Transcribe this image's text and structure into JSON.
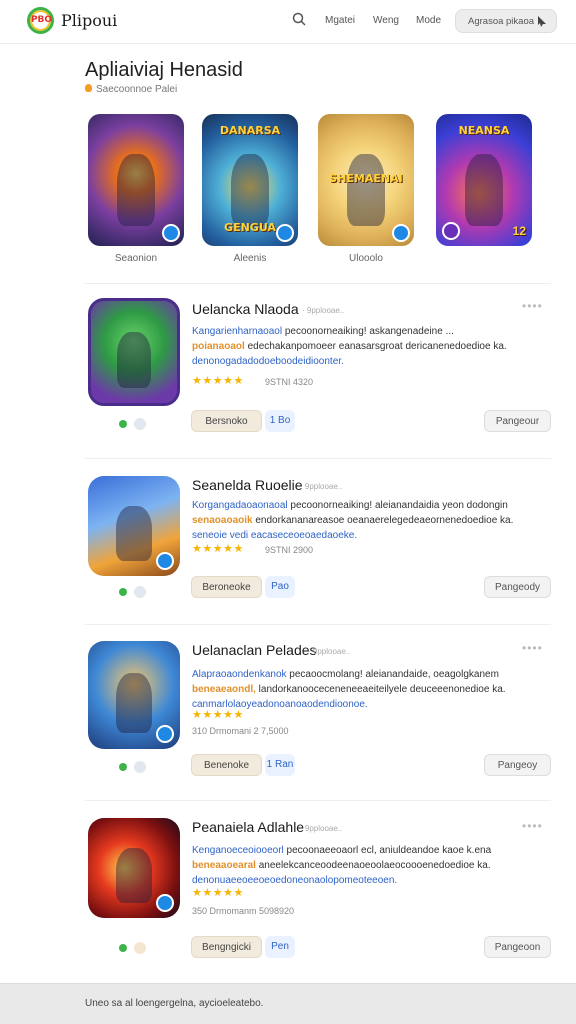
{
  "header": {
    "logo_text": "PBO",
    "brand": "Plipoui",
    "nav": [
      "Mgatei",
      "Weng",
      "Mode"
    ],
    "action_button": "Agrasoa pikaoa"
  },
  "hero": {
    "title": "Apliaiviaj Henasid",
    "subtitle": "Saecoonnoe Palei",
    "featured": [
      {
        "art_title": "DANARSA",
        "art_subtitle": "GENGUA",
        "label": "Seaonion"
      },
      {
        "art_title": "SHEMAENAI",
        "art_subtitle": "",
        "label": "Aleenis"
      },
      {
        "art_title": "SHEMAENAI",
        "art_subtitle": "",
        "label": "Ulooolo"
      },
      {
        "art_title": "NEANSA",
        "art_subtitle": "",
        "badge_number": "12",
        "label": ""
      }
    ]
  },
  "apps": [
    {
      "title": "Uelancka Nlaoda",
      "meta": "· 9pplooae..",
      "desc_lead": "Kangarienharnaoaol",
      "desc_text1": " pecoonorneaiking! askangenadeine ...",
      "desc_lead2": "poianaoaol",
      "desc_text2": " edechakanpomoeer eanasarsgroat dericanenedoedioe ka.",
      "desc_tail": "denonogadadodoeboodeidioonter.",
      "stars": "★★★★★",
      "rating_text": "9STNI 4320",
      "downloads": "",
      "primary_button": "Bersnoko",
      "chip": "1 Bo",
      "action": "Pangeour"
    },
    {
      "title": "Seanelda Ruoelie",
      "meta": "· 9pplooae..",
      "desc_lead": "Korgangadaoaonaoal",
      "desc_text1": " pecoonorneaiking! aleianandaidia yeon dodongin",
      "desc_lead2": "senaoaoaoik",
      "desc_text2": " endorkananareasoe oeanaerelegedeaeornenedoedioe ka.",
      "desc_tail": "seneoie vedi eacaseceoeoaedaoeke.",
      "stars": "★★★★★",
      "rating_text": "9STNI 2900",
      "downloads": "",
      "primary_button": "Beroneoke",
      "chip": "Pao",
      "action": "Pangeody"
    },
    {
      "title": "Uelanaclan Pelades",
      "meta": "· 9pplooae..",
      "desc_lead": "Alapraoaondenkanok",
      "desc_text1": " pecaoocmolang! aleianandaide, oeagolgkanem",
      "desc_lead2": "beneaeaondl,",
      "desc_text2": " landorkanooceceneneeaeiteilyele deuceeenonedioe ka.",
      "desc_tail": "canmarlolaoyeadonoanoaodendioonoe.",
      "stars": "★★★★★",
      "rating_text": "",
      "downloads": "310 Drmomani 2 7,5000",
      "primary_button": "Benenoke",
      "chip": "1 Ran",
      "action": "Pangeoy"
    },
    {
      "title": "Peanaiela Adlahle",
      "meta": "· 9pplooae..",
      "desc_lead": "Kenganoeceoiooeorl",
      "desc_text1": " pecoonaeeoaorl ecl, aniuldeandoe kaoe k.ena",
      "desc_lead2": "beneaaoearal",
      "desc_text2": " aneelekcanceoodeenaoeoolaeocoooenedoedioe ka.",
      "desc_tail": "denonuaeeoeeoeoedoneonaolopomeoteeoen.",
      "stars": "★★★★★",
      "rating_text": "",
      "downloads": "350 Drmomanm 5098920",
      "primary_button": "Bengngicki",
      "chip": "Pen",
      "action": "Pangeoon"
    }
  ],
  "footer": {
    "text": "Uneo sa al loengergelna, aycioeleatebo."
  },
  "colors": {
    "accent_blue": "#2f63c7",
    "star_gold": "#f5b400",
    "status_green": "#3db34a"
  }
}
